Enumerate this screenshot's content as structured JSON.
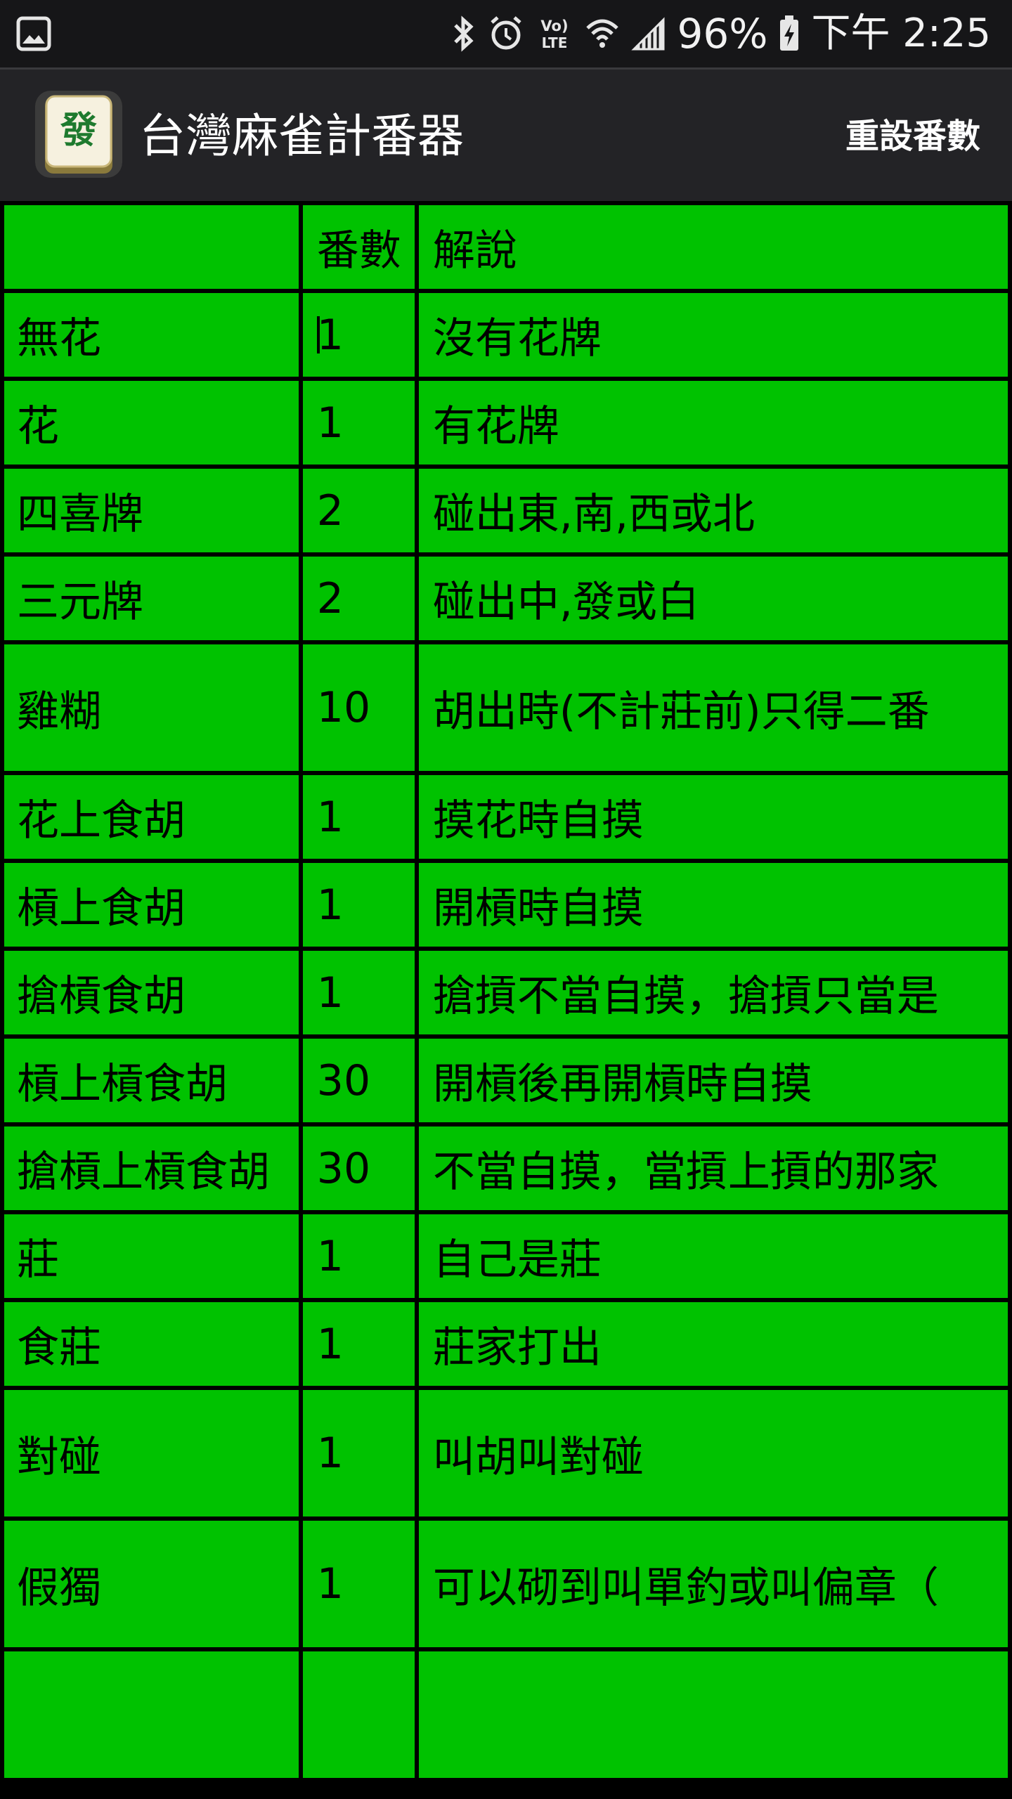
{
  "status_bar": {
    "battery_percent": "96%",
    "time": "下午 2:25",
    "icons": [
      "gallery-icon",
      "bluetooth-icon",
      "alarm-icon",
      "volte-icon",
      "wifi-icon",
      "signal-icon",
      "battery-charging-icon"
    ]
  },
  "app": {
    "title": "台灣麻雀計番器",
    "reset_label": "重設番數",
    "icon": "mahjong-fa-tile-icon",
    "tile_glyph": "發"
  },
  "colors": {
    "cell_green": "#00c200",
    "grid_black": "#000000",
    "action_bar": "#232326",
    "status_bar": "#161618"
  },
  "table": {
    "headers": [
      "",
      "番數",
      "解說"
    ],
    "rows": [
      {
        "name": "無花",
        "fan": "1",
        "desc": "沒有花牌"
      },
      {
        "name": "花",
        "fan": "1",
        "desc": "有花牌"
      },
      {
        "name": "四喜牌",
        "fan": "2",
        "desc": "碰出東,南,西或北"
      },
      {
        "name": "三元牌",
        "fan": "2",
        "desc": "碰出中,發或白"
      },
      {
        "name": "雞糊",
        "fan": "10",
        "desc": "胡出時(不計莊前)只得二番"
      },
      {
        "name": "花上食胡",
        "fan": "1",
        "desc": "摸花時自摸"
      },
      {
        "name": "槓上食胡",
        "fan": "1",
        "desc": "開槓時自摸"
      },
      {
        "name": "搶槓食胡",
        "fan": "1",
        "desc": "搶摃不當自摸，搶摃只當是"
      },
      {
        "name": "槓上槓食胡",
        "fan": "30",
        "desc": "開槓後再開槓時自摸"
      },
      {
        "name": "搶槓上槓食胡",
        "fan": "30",
        "desc": "不當自摸，當摃上摃的那家"
      },
      {
        "name": "莊",
        "fan": "1",
        "desc": "自己是莊"
      },
      {
        "name": "食莊",
        "fan": "1",
        "desc": "莊家打出"
      },
      {
        "name": "對碰",
        "fan": "1",
        "desc": "叫胡叫對碰"
      },
      {
        "name": "假獨",
        "fan": "1",
        "desc": "可以砌到叫單釣或叫偏章（"
      }
    ]
  }
}
